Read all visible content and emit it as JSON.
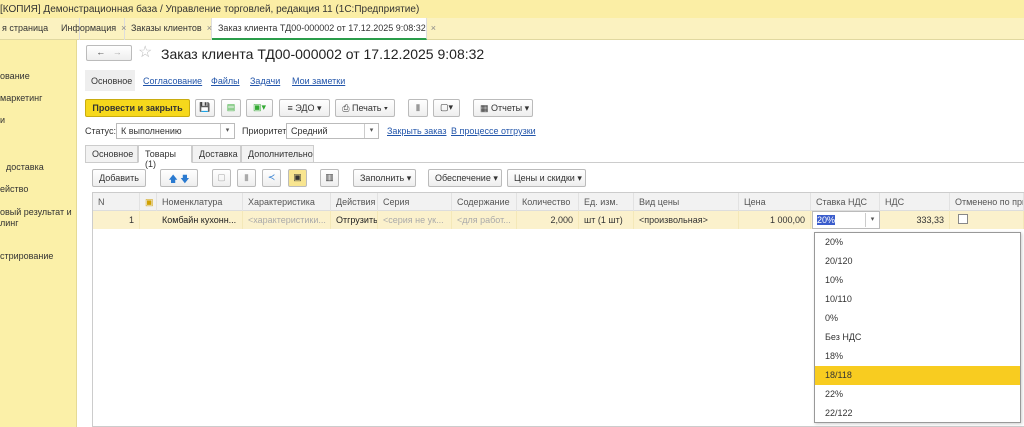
{
  "window_title": "[КОПИЯ] Демонстрационная база / Управление торговлей, редакция 11  (1С:Предприятие)",
  "window_tabs": [
    {
      "label": "я страница"
    },
    {
      "label": "Информация"
    },
    {
      "label": "Заказы клиентов"
    },
    {
      "label": "Заказ клиента ТД00-000002 от 17.12.2025 9:08:32"
    }
  ],
  "sidebar": [
    "ование",
    "маркетинг",
    "и",
    "доставка",
    "ейство",
    "овый результат и",
    "линг",
    "стрирование"
  ],
  "doc": {
    "title": "Заказ клиента ТД00-000002 от 17.12.2025 9:08:32",
    "nav": [
      "Основное",
      "Согласование",
      "Файлы",
      "Задачи",
      "Мои заметки"
    ],
    "toolbar": {
      "post_close": "Провести и закрыть",
      "edo": "ЭДО",
      "print": "Печать",
      "reports": "Отчеты"
    },
    "status_label": "Статус:",
    "status_value": "К выполнению",
    "priority_label": "Приоритет:",
    "priority_value": "Средний",
    "close_order": "Закрыть заказ",
    "shipping": "В процессе отгрузки",
    "form_tabs": [
      "Основное",
      "Товары (1)",
      "Доставка",
      "Дополнительно"
    ],
    "table_toolbar": {
      "add": "Добавить",
      "fill": "Заполнить",
      "supply": "Обеспечение",
      "prices": "Цены и скидки"
    },
    "columns": [
      "N",
      "Номенклатура",
      "Характеристика",
      "Действия",
      "Серия",
      "Содержание",
      "Количество",
      "Ед. изм.",
      "Вид цены",
      "Цена",
      "Ставка НДС",
      "НДС",
      "Отменено по причине"
    ],
    "row": {
      "n": "1",
      "item": "Комбайн кухонн...",
      "char": "<характеристики...",
      "action": "Отгрузить",
      "series": "<серия не ук...",
      "content": "<для работ...",
      "qty": "2,000",
      "unit": "шт (1 шт)",
      "price_type": "<произвольная>",
      "price": "1 000,00",
      "vat_rate": "20%",
      "vat": "333,33",
      "cancelled": false
    }
  },
  "vat_options": [
    "20%",
    "20/120",
    "10%",
    "10/110",
    "0%",
    "Без НДС",
    "18%",
    "18/118",
    "22%",
    "22/122"
  ],
  "vat_highlighted": "18/118"
}
